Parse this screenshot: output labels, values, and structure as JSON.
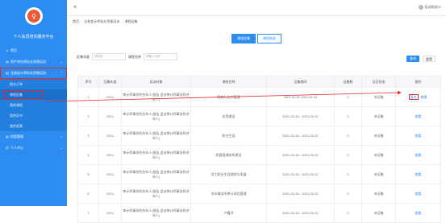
{
  "sidebar": {
    "logo_glyph": "♀",
    "title": "个人会员培训服务平台",
    "items": [
      {
        "icon": "⌂",
        "label": "首页"
      },
      {
        "icon": "▤",
        "label": "资产评估师执业资格培训",
        "chevron": "⌄"
      },
      {
        "icon": "▤",
        "label": "注册会计师执业资格培训",
        "chevron": "⌃",
        "highlighted": true
      },
      {
        "icon": "▤",
        "label": "档案管理",
        "chevron": "⌄"
      },
      {
        "icon": "☺",
        "label": "个人中心",
        "chevron": "⌄"
      }
    ],
    "sub_items": [
      "报名订单",
      "课程征集",
      "我的课程",
      "我的证书",
      "我的发票"
    ]
  },
  "topbar": {
    "menu_icon": "≡",
    "user_name": "培训测试01"
  },
  "breadcrumb": [
    "首页",
    "注册会计师执业资格培训",
    "课程征集"
  ],
  "tabs": [
    "课程征集",
    "课程纳采"
  ],
  "filter": {
    "year_label": "征集年度",
    "year_placeholder": "请选择",
    "name_label": "课程名称",
    "name_placeholder": "请输入名称",
    "search_label": "查询",
    "reset_label": "重置"
  },
  "table": {
    "headers": [
      "序号",
      "征集年度",
      "培训对象",
      "课程名称",
      "征集期间",
      "征集数",
      "征召状态",
      "操作"
    ],
    "rows": [
      {
        "no": "1",
        "year": "2021",
        "target": "审计师事务所合伙人(报告,会议审计师事务所合伙人)",
        "name": "财务行业外管理",
        "period": "2021-01-01 2021-01-31",
        "count": "0",
        "status": "未征集",
        "ops": [
          "报名",
          "查看"
        ]
      },
      {
        "no": "2",
        "year": "2021",
        "target": "审计师事务所合伙人(报告,会议审计师事务所合伙人)",
        "name": "应用建设",
        "period": "2021-01-15 - 2021-01-31",
        "count": "0",
        "status": "未征集",
        "ops": [
          "查看"
        ]
      },
      {
        "no": "3",
        "year": "2021",
        "target": "审计师事务所合伙人(报告,会议审计师事务所合伙人)",
        "name": "职业生涯",
        "period": "2021-01-15 - 2021-01-31",
        "count": "0",
        "status": "未征集",
        "ops": [
          "查看"
        ]
      },
      {
        "no": "4",
        "year": "2021",
        "target": "审计师事务所合伙人(报告,会议审计师事务所合伙人)",
        "name": "质量管理体系建设",
        "period": "2021-01-15 - 2021-01-31",
        "count": "0",
        "status": "未征集",
        "ops": [
          "查看"
        ]
      },
      {
        "no": "5",
        "year": "2021",
        "target": "审计师事务所合伙人(报告,会议审计师事务所合伙人)",
        "name": "员工职业生涯规划与发展",
        "period": "2021-01-15 - 2021-01-31",
        "count": "0",
        "status": "未征集",
        "ops": [
          "查看"
        ]
      },
      {
        "no": "6",
        "year": "2021",
        "target": "审计师事务所合伙人(报告,会议审计师事务所合伙人)",
        "name": "合伙事务所审计风险管理",
        "period": "2021-01-15 - 2021-01-31",
        "count": "0",
        "status": "未征集",
        "ops": [
          "查看"
        ]
      },
      {
        "no": "7",
        "year": "2021",
        "target": "审计师事务所合伙人(报告,会议审计师事务所合伙人)",
        "name": "户籍评",
        "period": "2021-01-15 - 2021-01-31",
        "count": "0",
        "status": "未征集",
        "ops": [
          "查看"
        ]
      }
    ]
  },
  "colors": {
    "sidebar": "#2d8cf0",
    "highlight": "#e02828",
    "link": "#2d8cf0"
  }
}
